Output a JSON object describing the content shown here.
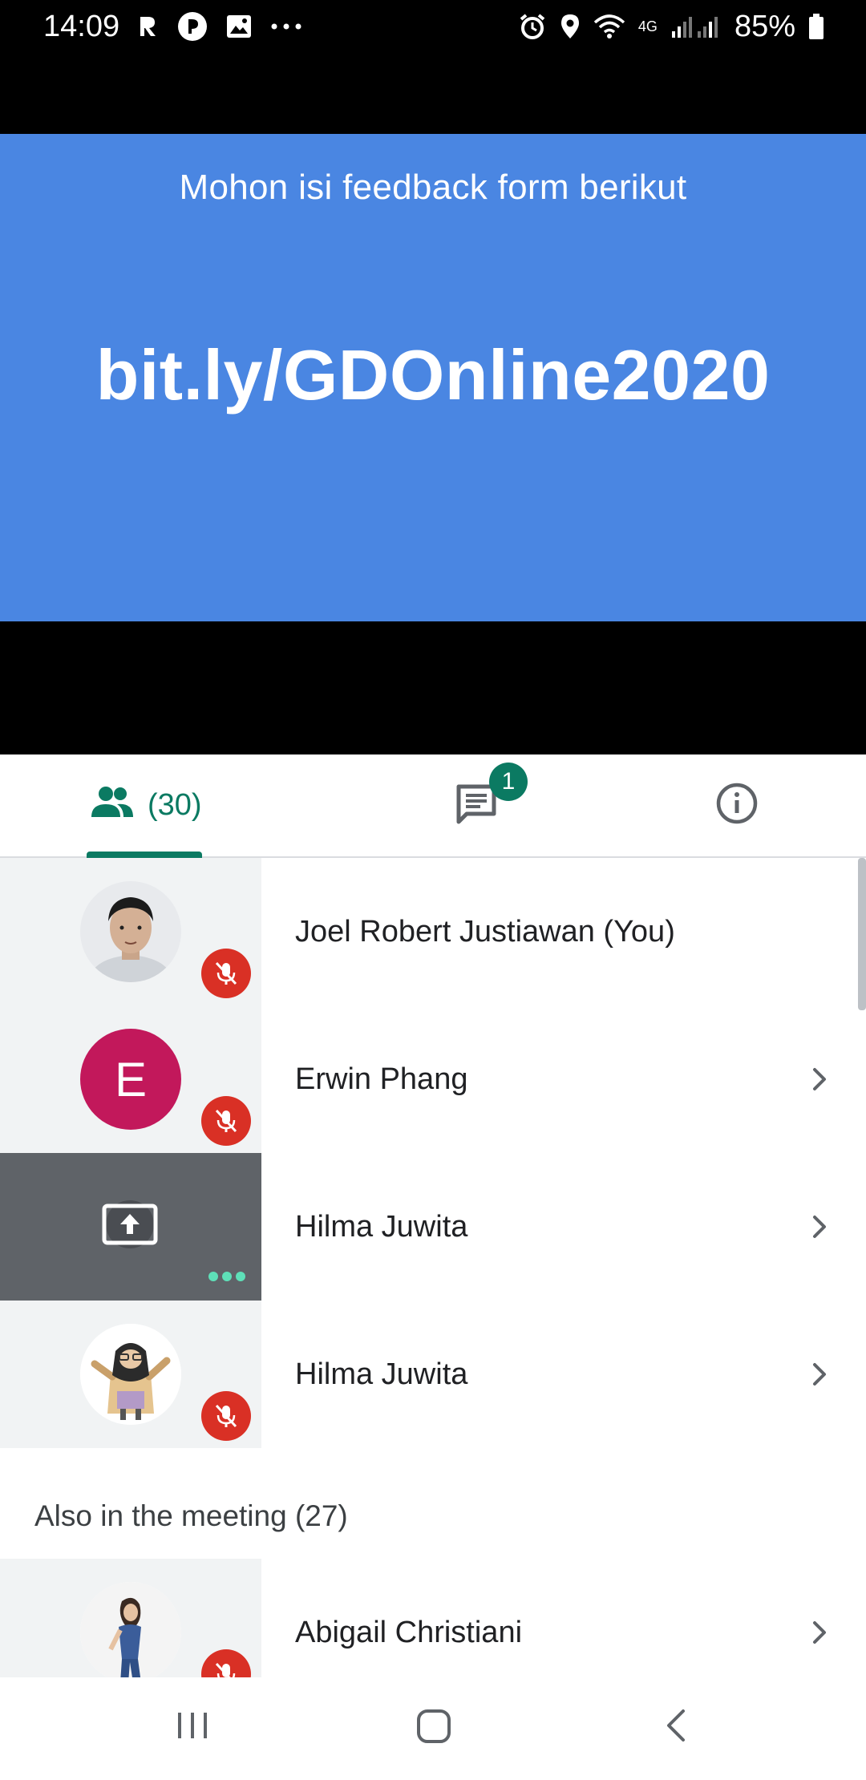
{
  "status_bar": {
    "time": "14:09",
    "battery": "85%",
    "network": "4G",
    "icons": [
      "r-icon",
      "pocket-casts-icon",
      "gallery-icon",
      "more-icon",
      "alarm-icon",
      "location-icon",
      "wifi-icon",
      "signal-icon",
      "battery-icon"
    ]
  },
  "slide": {
    "subtitle": "Mohon isi feedback form berikut",
    "link": "bit.ly/GDOnline2020",
    "background": "#4a86e2"
  },
  "tabs": {
    "people_count": "(30)",
    "chat_badge": "1"
  },
  "participants": [
    {
      "name": "Joel Robert Justiawan (You)",
      "avatar": "photo",
      "muted": true
    },
    {
      "name": "Erwin Phang",
      "avatar_letter": "E",
      "muted": true
    },
    {
      "name": "Hilma Juwita",
      "avatar": "presenting",
      "muted": false
    },
    {
      "name": "Hilma Juwita",
      "avatar": "illustration",
      "muted": true
    }
  ],
  "also_in_meeting": {
    "label": "Also in the meeting (27)",
    "participants": [
      {
        "name": "Abigail Christiani",
        "avatar": "photo",
        "muted": true
      }
    ]
  },
  "colors": {
    "accent": "#0b7a62",
    "muted_badge": "#d93025",
    "avatar_e": "#c2185b"
  }
}
